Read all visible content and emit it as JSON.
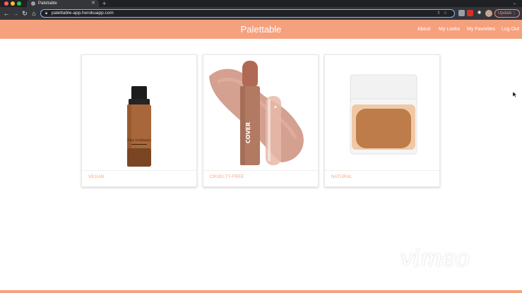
{
  "browser": {
    "tab_title": "Palettable",
    "url": "palettable-app.herokuapp.com",
    "update_label": "Update"
  },
  "navbar": {
    "brand": "Palettable",
    "links": [
      "About",
      "My Looks",
      "My Favorites",
      "Log Out"
    ]
  },
  "cards": [
    {
      "label": "VEGAN",
      "product_text": "The Ordinary"
    },
    {
      "label": "CRUELTY-FREE",
      "product_text": "COVER"
    },
    {
      "label": "NATURAL",
      "product_text": ""
    }
  ],
  "watermark": "vimeo",
  "colors": {
    "accent": "#f5a17e",
    "chrome": "#35363a",
    "foundation": "#a8673a",
    "compact_powder": "#c2814e"
  }
}
